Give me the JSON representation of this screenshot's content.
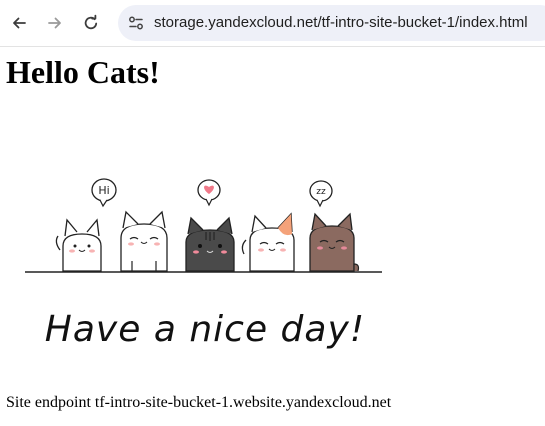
{
  "browser": {
    "url": "storage.yandexcloud.net/tf-intro-site-bucket-1/index.html",
    "back_icon": "arrow-left-icon",
    "forward_icon": "arrow-right-icon",
    "reload_icon": "reload-icon",
    "site_info_icon": "tune-icon"
  },
  "page": {
    "heading": "Hello Cats!",
    "image": {
      "speech_bubbles": [
        "Hi",
        "heart",
        "zz"
      ],
      "caption": "Have a nice day!",
      "cat_colors": [
        "#ffffff",
        "#ffffff",
        "#4a4a4a",
        "#ffffff",
        "#8b6a60"
      ]
    },
    "endpoint_text": "Site endpoint tf-intro-site-bucket-1.website.yandexcloud.net"
  }
}
